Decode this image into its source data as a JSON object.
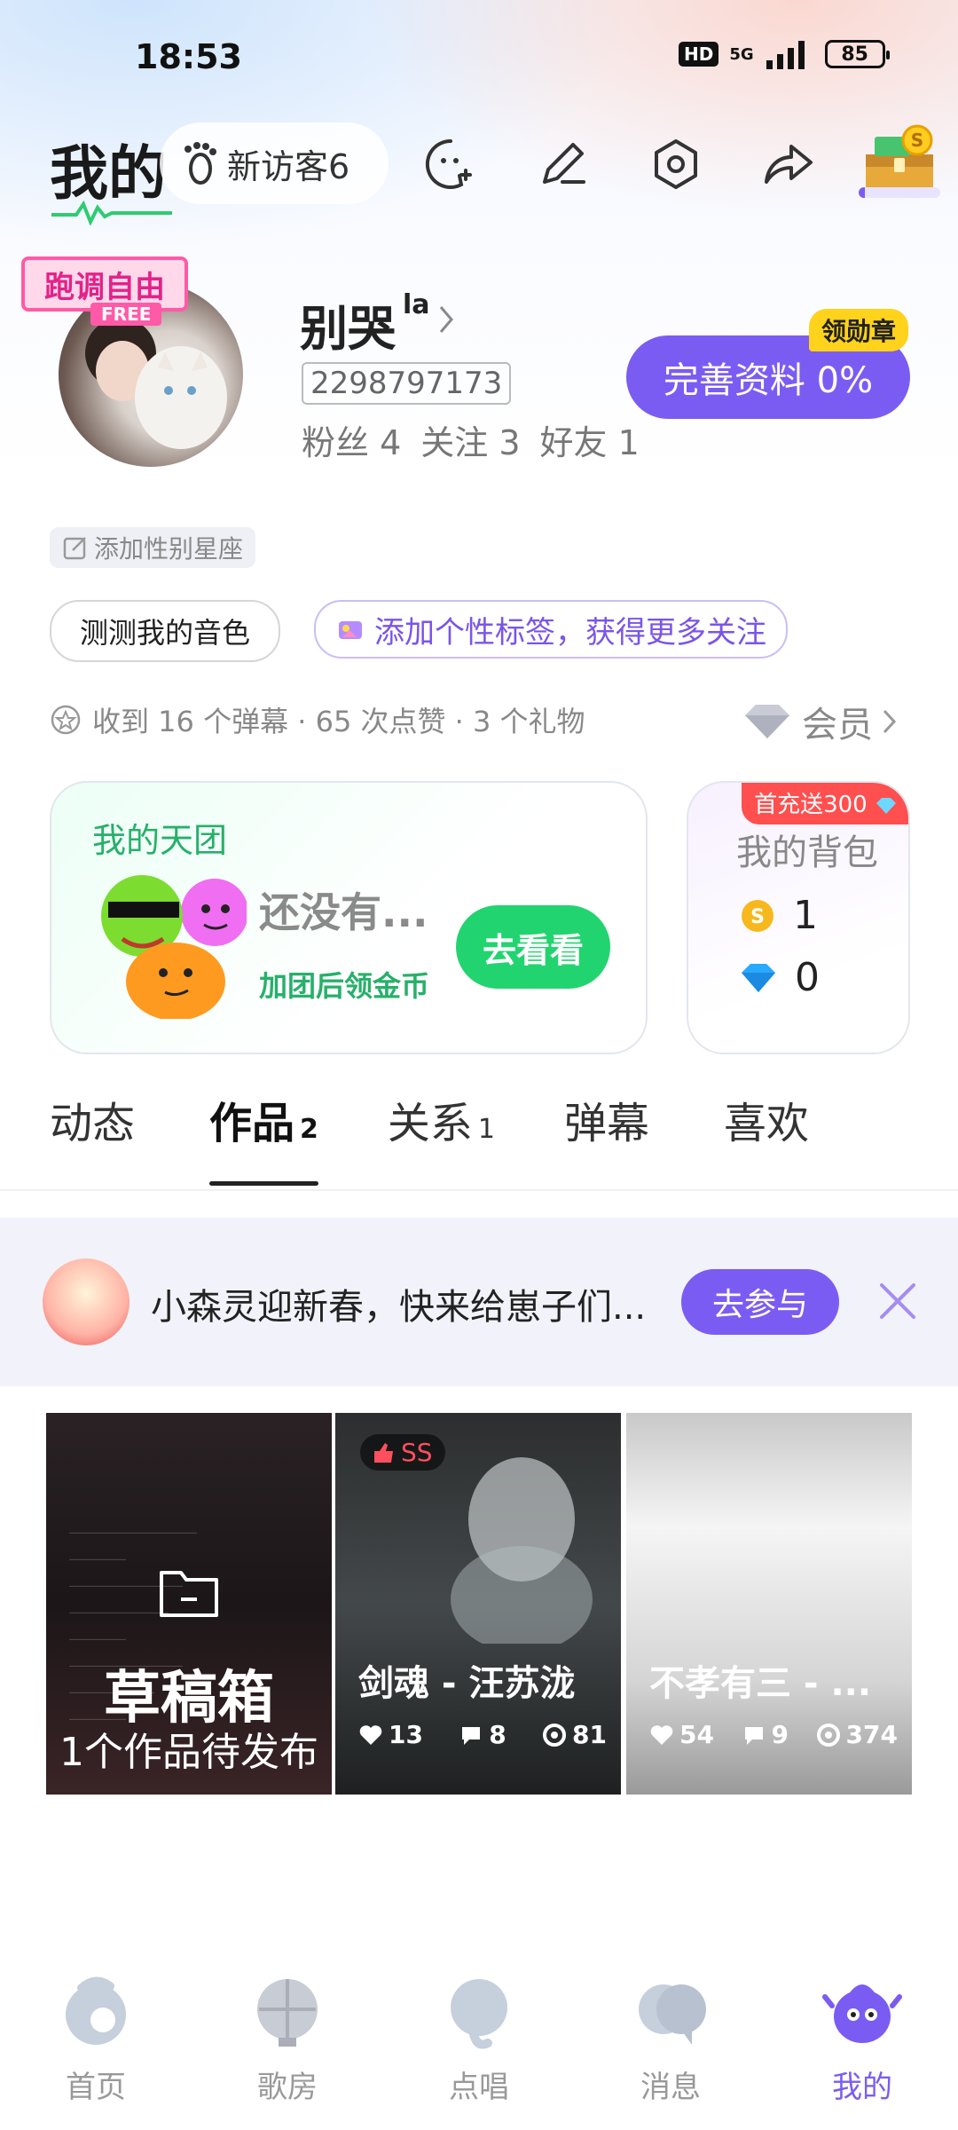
{
  "status_bar": {
    "time": "18:53",
    "hd": "HD",
    "network": "5G",
    "battery": "85"
  },
  "header": {
    "title": "我的",
    "visitors_label": "新访客6",
    "icons": [
      "chat-add-icon",
      "edit-pencil-icon",
      "settings-icon",
      "share-icon",
      "treasure-chest-icon"
    ]
  },
  "profile": {
    "avatar_badge": {
      "line1": "跑调自由",
      "line2": "FREE"
    },
    "username": "别哭",
    "username_sup": "la",
    "user_id": "2298797173",
    "stats": {
      "fans": "粉丝 4",
      "following": "关注 3",
      "friends": "好友 1"
    },
    "complete_button": "完善资料 0%",
    "medal_badge": "领勋章",
    "gender_tag": "添加性别星座",
    "chip_voice": "测测我的音色",
    "chip_tags": "添加个性标签，获得更多关注",
    "summary": "收到 16 个弹幕 · 65 次点赞 · 3 个礼物",
    "vip_label": "会员"
  },
  "team_card": {
    "title": "我的天团",
    "empty_text": "还没有...",
    "hint": "加团后领金币",
    "button": "去看看"
  },
  "bag_card": {
    "promo": "首充送300",
    "title": "我的背包",
    "coins": "1",
    "diamonds": "0"
  },
  "tabs": [
    {
      "label": "动态",
      "count": ""
    },
    {
      "label": "作品",
      "count": "2"
    },
    {
      "label": "关系",
      "count": "1"
    },
    {
      "label": "弹幕",
      "count": ""
    },
    {
      "label": "喜欢",
      "count": ""
    }
  ],
  "banner": {
    "text": "小森灵迎新春，快来给崽子们...",
    "button": "去参与"
  },
  "works": {
    "draft": {
      "title": "草稿箱",
      "subtitle": "1个作品待发布"
    },
    "items": [
      {
        "badge": "SS",
        "title": "剑魂 - 汪苏泷",
        "likes": "13",
        "comments": "8",
        "plays": "81"
      },
      {
        "title": "不孝有三 - ...",
        "likes": "54",
        "comments": "9",
        "plays": "374"
      }
    ]
  },
  "bottom_nav": [
    {
      "label": "首页",
      "icon": "home-icon"
    },
    {
      "label": "歌房",
      "icon": "ktv-room-icon"
    },
    {
      "label": "点唱",
      "icon": "sing-icon"
    },
    {
      "label": "消息",
      "icon": "message-icon"
    },
    {
      "label": "我的",
      "icon": "profile-mascot-icon",
      "active": true
    }
  ],
  "colors": {
    "accent": "#7b5cf2",
    "green": "#22d46f",
    "promo_red": "#ff4f4f",
    "badge_yellow": "#ffd21c"
  }
}
